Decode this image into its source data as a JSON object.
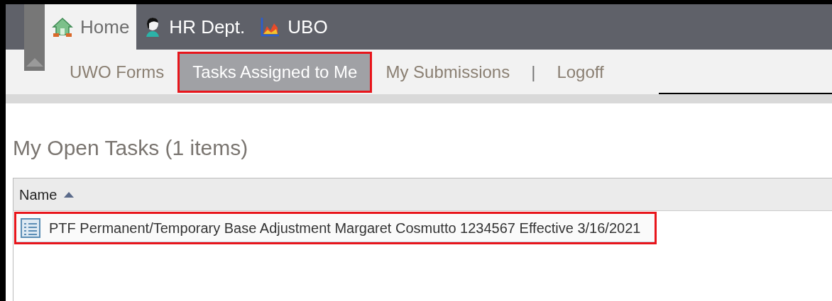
{
  "top_tabs": [
    {
      "label": "Home",
      "kind": "house",
      "selected": true
    },
    {
      "label": "HR Dept.",
      "kind": "person",
      "selected": false
    },
    {
      "label": "UBO",
      "kind": "chart",
      "selected": false
    }
  ],
  "sub_nav": [
    {
      "kind": "link",
      "label": "UWO Forms",
      "selected": false,
      "highlighted": false
    },
    {
      "kind": "link",
      "label": "Tasks Assigned to Me",
      "selected": true,
      "highlighted": true
    },
    {
      "kind": "link",
      "label": "My Submissions",
      "selected": false,
      "highlighted": false
    },
    {
      "kind": "separator",
      "label": "|"
    },
    {
      "kind": "link",
      "label": "Logoff",
      "selected": false,
      "highlighted": false
    }
  ],
  "page_title": "My Open Tasks (1 items)",
  "table": {
    "columns": [
      {
        "label": "Name",
        "sort_ascending": true
      }
    ],
    "rows": [
      {
        "name": "PTF Permanent/Temporary Base Adjustment Margaret Cosmutto 1234567 Effective 3/16/2021",
        "highlighted": true
      }
    ]
  }
}
